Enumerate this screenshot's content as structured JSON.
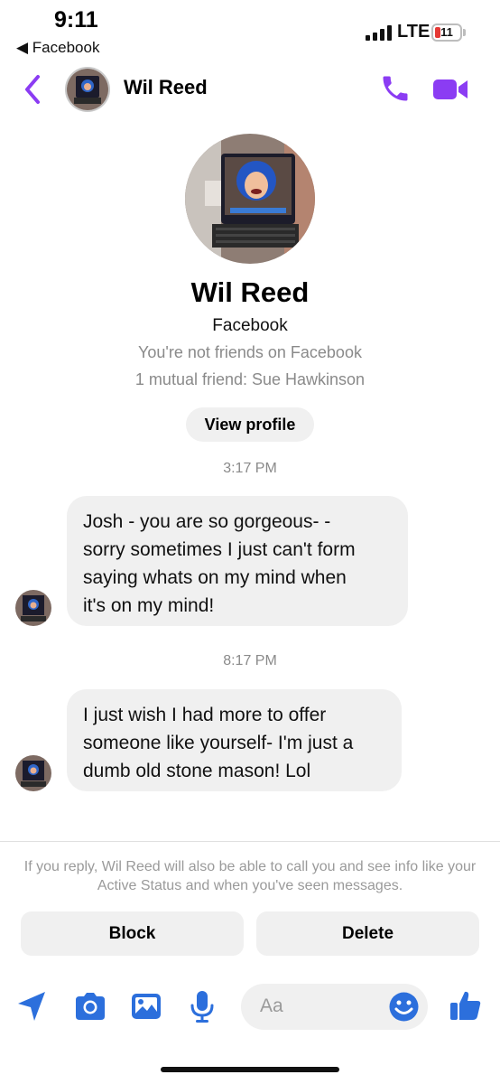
{
  "status_bar": {
    "time": "9:11",
    "back_app": "◀ Facebook",
    "network": "LTE",
    "battery": "11"
  },
  "header": {
    "name": "Wil Reed",
    "icons": {
      "back": "chevron-left-icon",
      "call": "phone-icon",
      "video": "video-camera-icon"
    }
  },
  "profile": {
    "name": "Wil Reed",
    "subtitle": "Facebook",
    "not_friends": "You're not friends on Facebook",
    "mutual": "1 mutual friend: Sue Hawkinson",
    "view_profile_label": "View profile"
  },
  "messages": [
    {
      "timestamp": "3:17 PM",
      "lines": [
        "Josh - you are so gorgeous- -",
        "sorry sometimes I just can't form",
        "saying whats on my mind when",
        "it's on my mind!"
      ]
    },
    {
      "timestamp": "8:17 PM",
      "lines": [
        "I just wish I had more to offer",
        "someone like yourself- I'm just a",
        "dumb old stone mason! Lol"
      ]
    }
  ],
  "notice": "If you reply, Wil Reed will also be able to call you and see info like your Active Status and when you've seen messages.",
  "actions": {
    "block": "Block",
    "delete": "Delete"
  },
  "composer": {
    "placeholder": "Aa",
    "icons": [
      "location-arrow-icon",
      "camera-icon",
      "image-icon",
      "microphone-icon",
      "emoji-icon",
      "thumbs-up-icon"
    ]
  },
  "colors": {
    "accent_purple": "#8b3cf3",
    "accent_blue": "#2c6fdc",
    "bubble_grey": "#f0f0f0"
  }
}
